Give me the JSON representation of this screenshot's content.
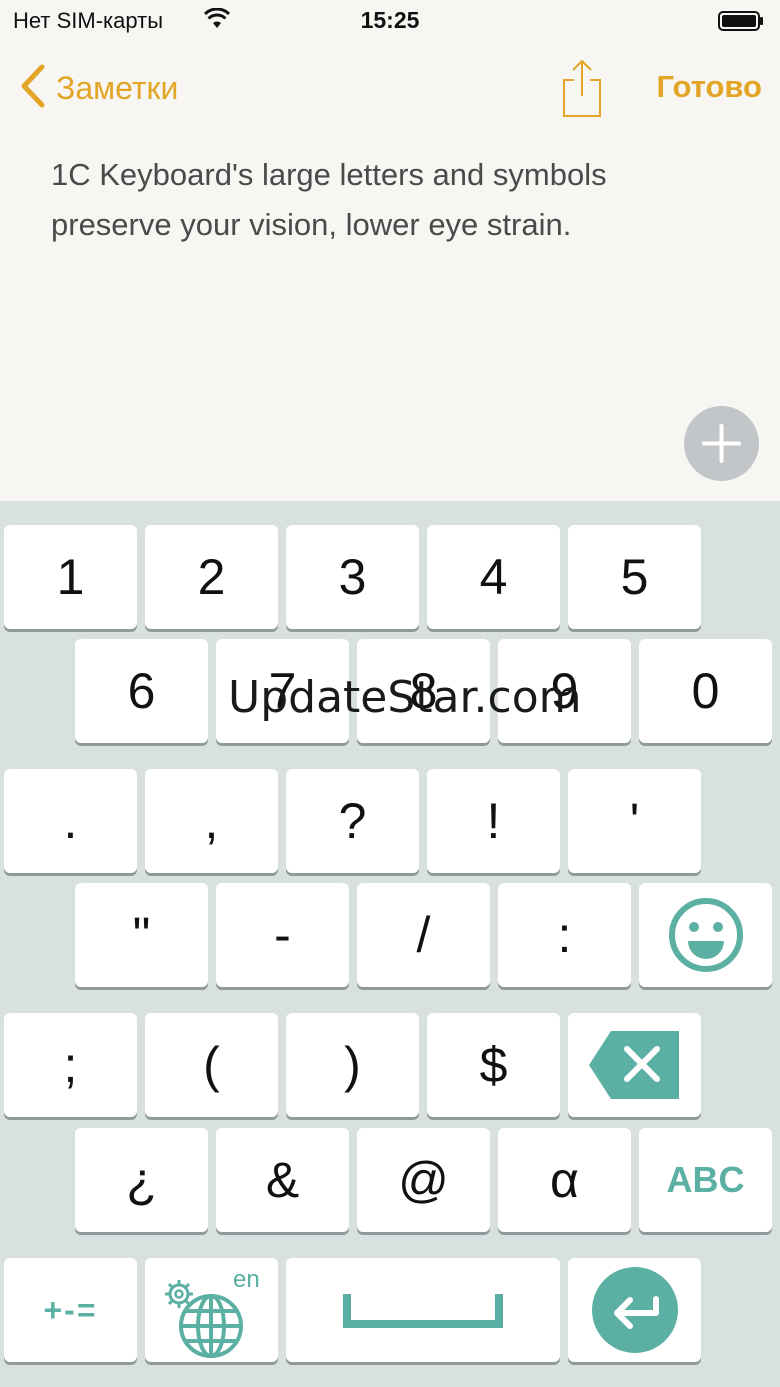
{
  "status_bar": {
    "carrier": "Нет SIM-карты",
    "time": "15:25",
    "wifi_icon": "wifi-icon",
    "battery_icon": "battery-icon"
  },
  "nav": {
    "back_label": "Заметки",
    "done_label": "Готово",
    "share_icon": "share-icon",
    "accent_color": "#e2a526"
  },
  "note": {
    "text_line1": "1C Keyboard's large letters and symbols",
    "text_line2": "preserve your vision, lower eye strain."
  },
  "keyboard": {
    "accent_color": "#5bb0a3",
    "row1": [
      "1",
      "2",
      "3",
      "4",
      "5"
    ],
    "row2": [
      "6",
      "7",
      "8",
      "9",
      "0"
    ],
    "row3": [
      ".",
      ",",
      "?",
      "!",
      "'"
    ],
    "row4": [
      "\"",
      "-",
      "/",
      ":"
    ],
    "row5": [
      ";",
      "(",
      ")",
      "$"
    ],
    "row6": [
      "¿",
      "&",
      "@",
      "α"
    ],
    "abc_label": "ABC",
    "symbols_label": "+-=",
    "language_label": "en"
  },
  "watermark": "UpdateStar.com"
}
